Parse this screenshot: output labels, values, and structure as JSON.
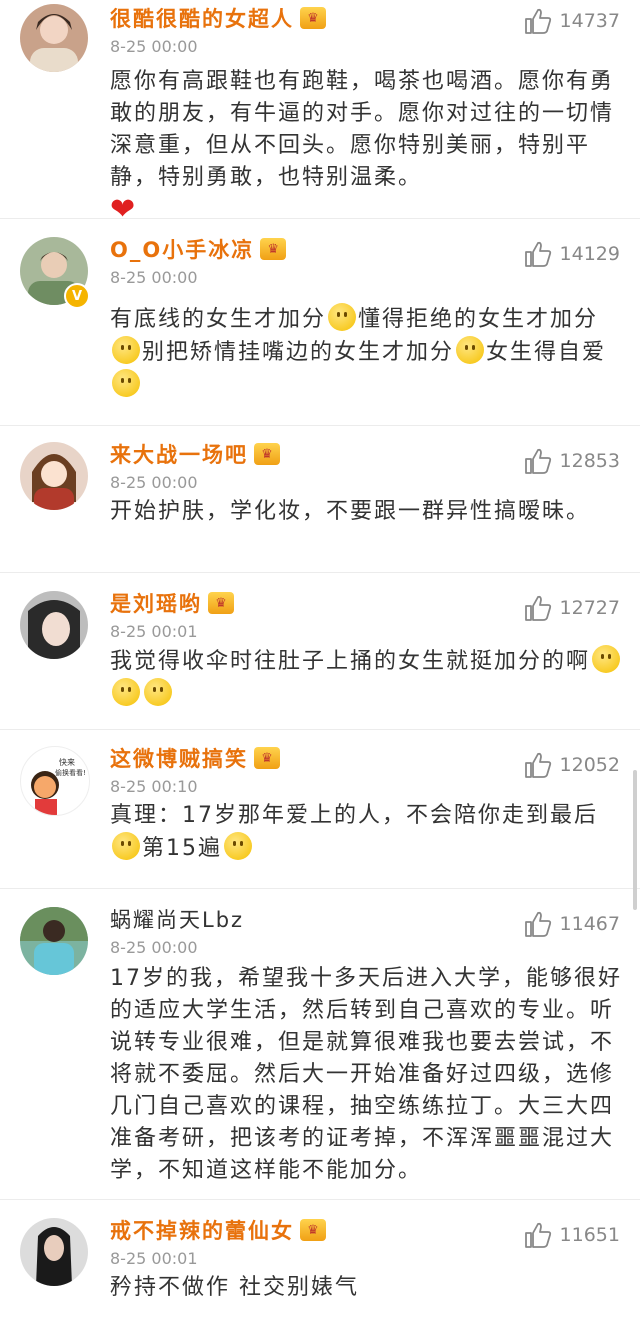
{
  "comments": [
    {
      "name": "很酷很酷的女超人",
      "time": "8-25 00:00",
      "likes": "14737",
      "text": "愿你有高跟鞋也有跑鞋，喝茶也喝酒。愿你有勇敢的朋友，有牛逼的对手。愿你对过往的一切情深意重，但从不回头。愿你特别美丽，特别平静，特别勇敢，也特别温柔。",
      "avatar_color": "#c9a28a"
    },
    {
      "name": "O_O小手冰凉",
      "time": "8-25 00:00",
      "likes": "14129",
      "text_parts": [
        "有底线的女生才加分",
        "懂得拒绝的女生才加分",
        "别把矫情挂嘴边的女生才加分",
        "女生得自爱"
      ],
      "avatar_color": "#7f9a73",
      "verified": "V"
    },
    {
      "name": "来大战一场吧",
      "time": "8-25 00:00",
      "likes": "12853",
      "text": "开始护肤，学化妆，不要跟一群异性搞暧昧。",
      "avatar_color": "#8a5a3a"
    },
    {
      "name": "是刘瑶哟",
      "time": "8-25 00:01",
      "likes": "12727",
      "text": "我觉得收伞时往肚子上捅的女生就挺加分的啊",
      "avatar_color": "#9a9a9a"
    },
    {
      "name": "这微博贼搞笑",
      "time": "8-25 00:10",
      "likes": "12052",
      "text_parts": [
        "真理：17岁那年爱上的人，不会陪你走到最后",
        "第15遍"
      ],
      "avatar_color": "#f2d9b1",
      "avatar_caption": "快来\n偷换看看！"
    },
    {
      "name": "蜗耀尚天Lbz",
      "time": "8-25 00:00",
      "likes": "11467",
      "text": "17岁的我，希望我十多天后进入大学，能够很好的适应大学生活，然后转到自己喜欢的专业。听说转专业很难，但是就算很难我也要去尝试，不将就不委屈。然后大一开始准备好过四级，选修几门自己喜欢的课程，抽空练练拉丁。大三大四准备考研，把该考的证考掉，不浑浑噩噩混过大学，不知道这样能不能加分。",
      "avatar_color": "#5aa8b5"
    },
    {
      "name": "戒不掉辣的蕾仙女",
      "time": "8-25 00:01",
      "likes": "11651",
      "text": "矜持不做作  社交别婊气",
      "avatar_color": "#333333"
    }
  ],
  "icons": {
    "like": "thumbs-up-icon",
    "crown": "member-crown-icon",
    "heart": "red-heart-icon",
    "smile": "smile-emoji-icon"
  }
}
